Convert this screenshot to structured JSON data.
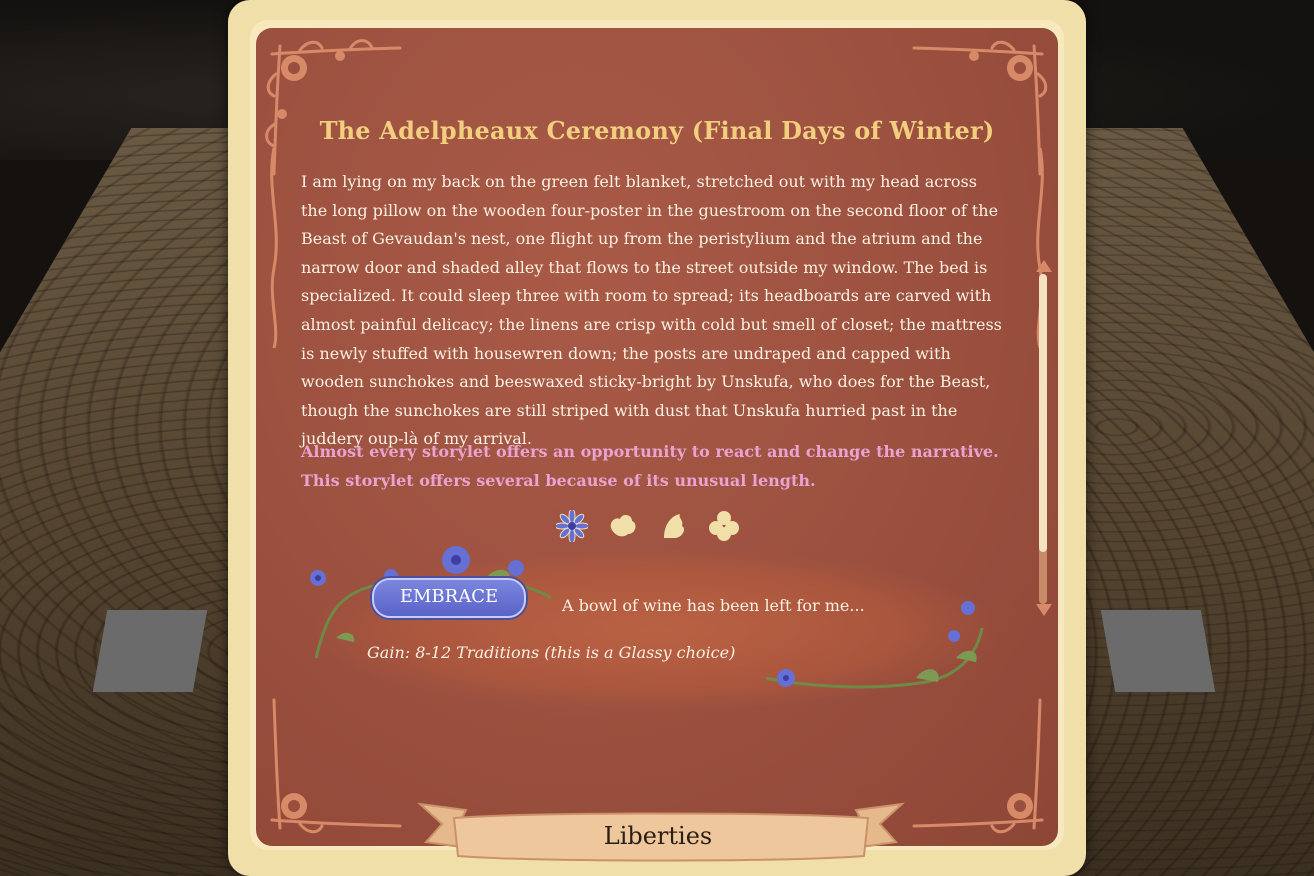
{
  "storylet": {
    "title": "The Adelpheaux Ceremony (Final Days of Winter)",
    "body": "I am lying on my back on the green felt blanket, stretched out with my head across the long pillow on the wooden four-poster in the guestroom on the second floor of the Beast of Gevaudan's nest, one flight up from the peristylium and the atrium and the narrow door and shaded alley that flows to the street outside my window. The bed is specialized. It could sleep three with room to spread; its headboards are carved with almost painful delicacy; the linens are crisp with cold but smell of closet; the mattress is newly stuffed with housewren down; the posts are undraped and capped with wooden sunchokes and beeswaxed sticky-bright by Unskufa, who does for the Beast, though the sunchokes are still striped with dust that Unskufa hurried past in the juddery oup-là of my arrival.",
    "note": "Almost every storylet offers an opportunity to react and change the narrative. This storylet offers several because of its unusual length."
  },
  "aspects": [
    {
      "icon": "chicory-flower-icon",
      "active": true
    },
    {
      "icon": "cloud-flower-icon",
      "active": false
    },
    {
      "icon": "leaf-icon",
      "active": false
    },
    {
      "icon": "round-flower-icon",
      "active": false
    }
  ],
  "choice": {
    "button_label": "EMBRACE",
    "text": "A bowl of wine has been left for me...",
    "gain": "Gain: 8-12 Traditions (this is a Glassy choice)"
  },
  "ribbon": {
    "label": "Liberties"
  },
  "colors": {
    "title": "#f2cf7f",
    "note": "#e9a3d0",
    "panel": "#9a4f3e",
    "frame": "#f1dfa9",
    "button": "#6670d4"
  }
}
